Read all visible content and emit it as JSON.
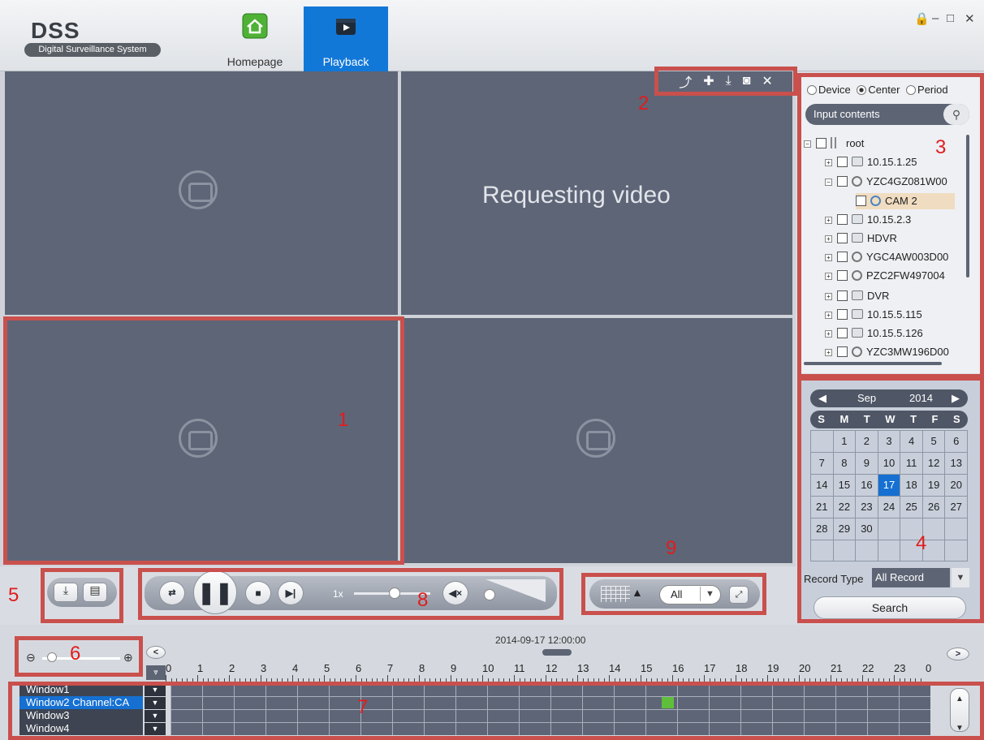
{
  "app": {
    "logo_title": "DSS",
    "logo_subtitle": "Digital Surveillance System"
  },
  "nav": {
    "home_label": "Homepage",
    "playback_label": "Playback"
  },
  "window_controls": {
    "lock": "🔒",
    "minimize": "–",
    "maximize": "□",
    "close": "✕"
  },
  "video": {
    "requesting_text": "Requesting video"
  },
  "annotations": {
    "n1": "1",
    "n2": "2",
    "n3": "3",
    "n4": "4",
    "n5": "5",
    "n6": "6",
    "n7": "7",
    "n8": "8",
    "n9": "9"
  },
  "toolbar": {
    "export_icon": "⤴",
    "pin_icon": "✚",
    "download_icon": "⤓",
    "snapshot_icon": "◙",
    "close_icon": "✕"
  },
  "source": {
    "device_label": "Device",
    "center_label": "Center",
    "period_label": "Period",
    "search_placeholder": "Input contents",
    "tree": [
      {
        "label": "root"
      },
      {
        "label": "10.15.1.25"
      },
      {
        "label": "YZC4GZ081W00"
      },
      {
        "label": "CAM 2"
      },
      {
        "label": "10.15.2.3"
      },
      {
        "label": "HDVR"
      },
      {
        "label": "YGC4AW003D00"
      },
      {
        "label": "PZC2FW497004"
      },
      {
        "label": "DVR"
      },
      {
        "label": "10.15.5.115"
      },
      {
        "label": "10.15.5.126"
      },
      {
        "label": "YZC3MW196D00"
      }
    ]
  },
  "calendar": {
    "month": "Sep",
    "year": "2014",
    "dow": [
      "S",
      "M",
      "T",
      "W",
      "T",
      "F",
      "S"
    ],
    "days": [
      "",
      "1",
      "2",
      "3",
      "4",
      "5",
      "6",
      "7",
      "8",
      "9",
      "10",
      "11",
      "12",
      "13",
      "14",
      "15",
      "16",
      "17",
      "18",
      "19",
      "20",
      "21",
      "22",
      "23",
      "24",
      "25",
      "26",
      "27",
      "28",
      "29",
      "30",
      "",
      "",
      "",
      "",
      "",
      "",
      "",
      "",
      "",
      "",
      ""
    ],
    "selected_day": "17",
    "record_type_label": "Record Type",
    "record_type_value": "All Record",
    "search_label": "Search"
  },
  "playback": {
    "speed": "1x",
    "speed_level": 0.4,
    "volume_level": 0.05
  },
  "view": {
    "stream_value": "All"
  },
  "timeline": {
    "timestamp": "2014-09-17 12:00:00",
    "hours": [
      "0",
      "1",
      "2",
      "3",
      "4",
      "5",
      "6",
      "7",
      "8",
      "9",
      "10",
      "11",
      "12",
      "13",
      "14",
      "15",
      "16",
      "17",
      "18",
      "19",
      "20",
      "21",
      "22",
      "23",
      "0"
    ],
    "windows": [
      "Window1",
      "Window2 Channel:CA",
      "Window3",
      "Window4"
    ],
    "selected_window": 1,
    "record_block": {
      "window": 1,
      "start_hour": 15.5,
      "end_hour": 15.9,
      "color": "#5fbf3a"
    }
  },
  "colors": {
    "accent": "#1278d8",
    "annotation_red": "#c9504d",
    "pane": "#5e6577"
  }
}
